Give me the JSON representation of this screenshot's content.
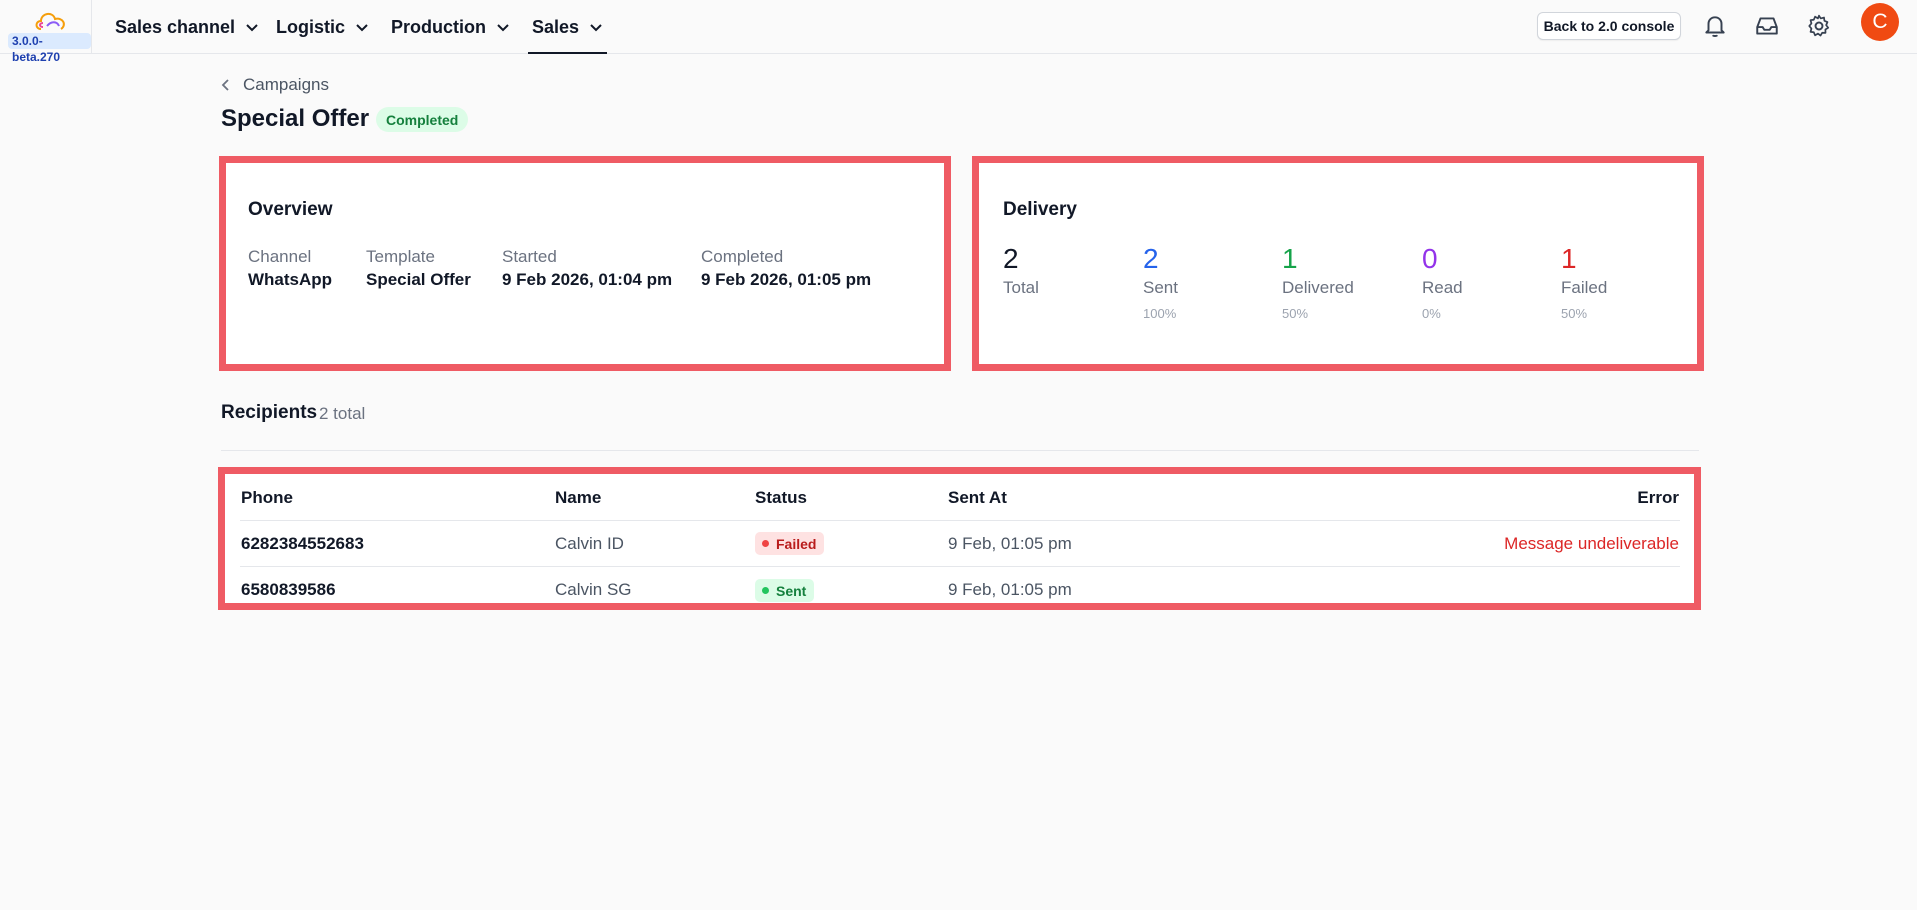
{
  "app": {
    "version": "3.0.0-beta.270",
    "nav": [
      {
        "label": "Sales channel"
      },
      {
        "label": "Logistic"
      },
      {
        "label": "Production"
      },
      {
        "label": "Sales",
        "active": true
      }
    ],
    "console_button": "Back to 2.0 console",
    "avatar_initial": "C",
    "icons": [
      "bell-icon",
      "inbox-icon",
      "gear-icon"
    ]
  },
  "breadcrumb": {
    "label": "Campaigns"
  },
  "campaign": {
    "title": "Special Offer",
    "status_badge": "Completed"
  },
  "overview": {
    "title": "Overview",
    "fields": [
      {
        "label": "Channel",
        "value": "WhatsApp"
      },
      {
        "label": "Template",
        "value": "Special Offer"
      },
      {
        "label": "Started",
        "value": "9 Feb 2026, 01:04 pm"
      },
      {
        "label": "Completed",
        "value": "9 Feb 2026, 01:05 pm"
      }
    ]
  },
  "delivery": {
    "title": "Delivery",
    "stats": [
      {
        "value": "2",
        "label": "Total",
        "pct": "",
        "color": "#111827"
      },
      {
        "value": "2",
        "label": "Sent",
        "pct": "100%",
        "color": "#2563eb"
      },
      {
        "value": "1",
        "label": "Delivered",
        "pct": "50%",
        "color": "#16a34a"
      },
      {
        "value": "0",
        "label": "Read",
        "pct": "0%",
        "color": "#9333ea"
      },
      {
        "value": "1",
        "label": "Failed",
        "pct": "50%",
        "color": "#dc2626"
      }
    ]
  },
  "recipients": {
    "title": "Recipients",
    "count": "2 total",
    "columns": [
      "Phone",
      "Name",
      "Status",
      "Sent At",
      "Error"
    ],
    "rows": [
      {
        "phone": "6282384552683",
        "name": "Calvin ID",
        "status": "Failed",
        "sent_at": "9 Feb, 01:05 pm",
        "error": "Message undeliverable"
      },
      {
        "phone": "6580839586",
        "name": "Calvin SG",
        "status": "Sent",
        "sent_at": "9 Feb, 01:05 pm",
        "error": ""
      }
    ]
  },
  "colors": {
    "highlight_border": "#ef5b64",
    "avatar": "#f04a12"
  }
}
